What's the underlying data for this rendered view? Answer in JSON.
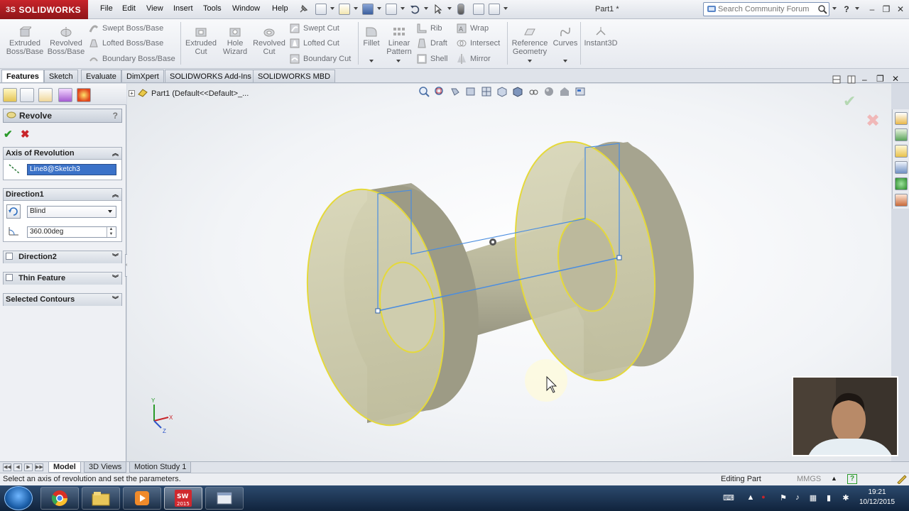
{
  "app": {
    "logo": "SOLIDWORKS",
    "logo_prefix": "3S",
    "document_title": "Part1 *"
  },
  "menu": [
    "File",
    "Edit",
    "View",
    "Insert",
    "Tools",
    "Window",
    "Help"
  ],
  "search": {
    "placeholder": "Search Community Forum"
  },
  "commands": {
    "extruded_boss": "Extruded Boss/Base",
    "revolved_boss": "Revolved Boss/Base",
    "swept_boss": "Swept Boss/Base",
    "lofted_boss": "Lofted Boss/Base",
    "boundary_boss": "Boundary Boss/Base",
    "extruded_cut": "Extruded Cut",
    "hole_wizard": "Hole Wizard",
    "revolved_cut": "Revolved Cut",
    "swept_cut": "Swept Cut",
    "lofted_cut": "Lofted Cut",
    "boundary_cut": "Boundary Cut",
    "fillet": "Fillet",
    "linear_pattern": "Linear Pattern",
    "rib": "Rib",
    "draft": "Draft",
    "shell": "Shell",
    "wrap": "Wrap",
    "intersect": "Intersect",
    "mirror": "Mirror",
    "reference_geometry": "Reference Geometry",
    "curves": "Curves",
    "instant3d": "Instant3D"
  },
  "tabs": [
    "Features",
    "Sketch",
    "Evaluate",
    "DimXpert",
    "SOLIDWORKS Add-Ins",
    "SOLIDWORKS MBD"
  ],
  "property_manager": {
    "title": "Revolve",
    "help": "?",
    "ok": "✔",
    "cancel": "✖",
    "axis_group": "Axis of Revolution",
    "axis_value": "Line8@Sketch3",
    "direction1_group": "Direction1",
    "direction1_type": "Blind",
    "direction1_angle": "360.00deg",
    "direction2_group": "Direction2",
    "thin_feature_group": "Thin Feature",
    "selected_contours_group": "Selected Contours"
  },
  "tree": {
    "label": "Part1  (Default<<Default>_..."
  },
  "bottom_tabs": [
    "Model",
    "3D Views",
    "Motion Study 1"
  ],
  "status": {
    "message": "Select an axis of revolution and set the parameters.",
    "mode": "Editing Part",
    "units": "MMGS"
  },
  "clock": {
    "time": "19:21",
    "date": "10/12/2015"
  },
  "triad": {
    "x": "X",
    "y": "Y",
    "z": "Z"
  },
  "colors": {
    "accent_red": "#c8242a",
    "model_fill": "#c9c7a4",
    "model_edge": "#e5d93a",
    "sketch_line": "#4a8de0",
    "taskbar": "#1a3352"
  }
}
